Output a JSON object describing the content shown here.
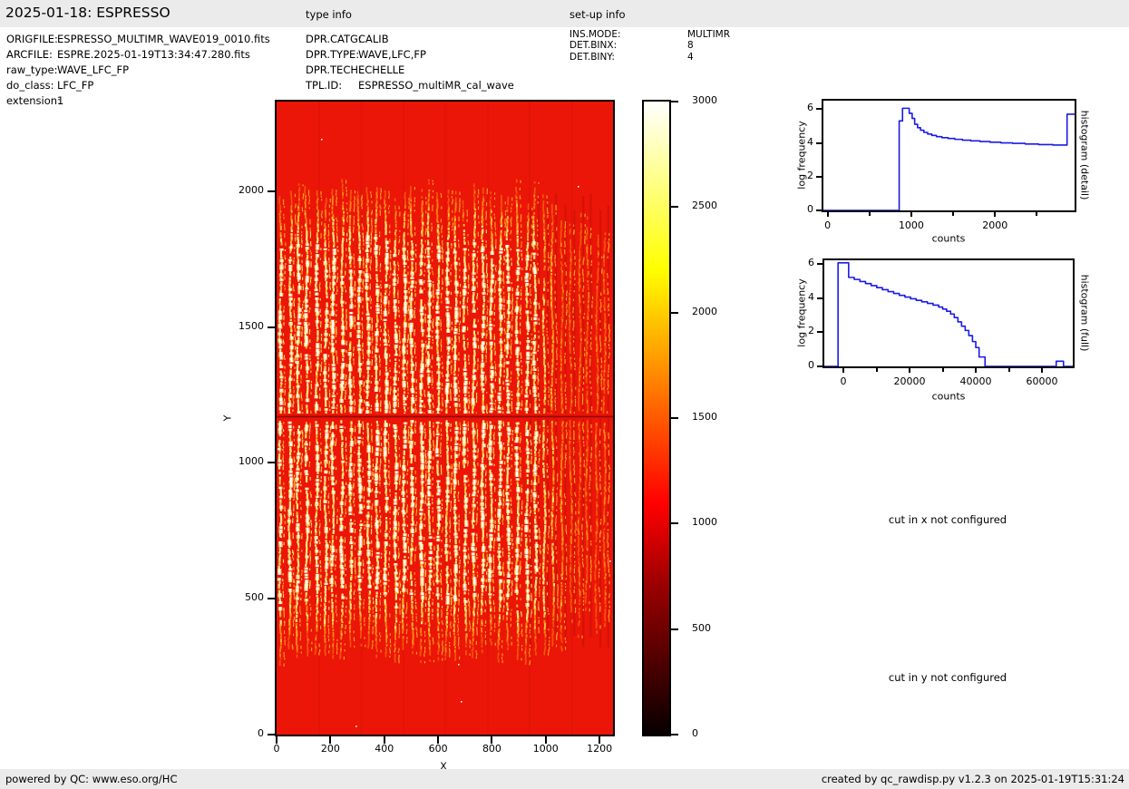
{
  "header": {
    "title": "2025-01-18: ESPRESSO",
    "type_info_label": "type info",
    "setup_info_label": "set-up info"
  },
  "file_info": [
    {
      "label": "ORIGFILE:",
      "value": "ESPRESSO_MULTIMR_WAVE019_0010.fits"
    },
    {
      "label": "ARCFILE:",
      "value": "ESPRE.2025-01-19T13:34:47.280.fits"
    },
    {
      "label": "raw_type:",
      "value": "WAVE_LFC_FP"
    },
    {
      "label": "do_class:",
      "value": "LFC_FP"
    },
    {
      "label": "extension:",
      "value": "1"
    }
  ],
  "type_info": [
    {
      "label": "DPR.CATG:",
      "value": "CALIB"
    },
    {
      "label": "DPR.TYPE:",
      "value": "WAVE,LFC,FP"
    },
    {
      "label": "DPR.TECH:",
      "value": "ECHELLE"
    },
    {
      "label": "TPL.ID:",
      "value": "ESPRESSO_multiMR_cal_wave"
    }
  ],
  "setup_info": [
    {
      "label": "INS.MODE:",
      "value": "MULTIMR"
    },
    {
      "label": "DET.BINX:",
      "value": "8"
    },
    {
      "label": "DET.BINY:",
      "value": "4"
    }
  ],
  "messages": {
    "cut_x": "cut in x not configured",
    "cut_y": "cut in y not configured"
  },
  "footer": {
    "left": "powered by QC: www.eso.org/HC",
    "right": "created by qc_rawdisp.py v1.2.3 on 2025-01-19T15:31:24"
  },
  "colors": {
    "image_red": "#eb1508",
    "histogram_line": "#1a1ae6",
    "panel_gray": "#ebebeb",
    "axis_black": "#000000"
  },
  "chart_data": [
    {
      "type": "heatmap",
      "name": "raw-frame",
      "xlabel": "X",
      "ylabel": "Y",
      "xticks": [
        0,
        200,
        400,
        600,
        800,
        1000,
        1200
      ],
      "yticks": [
        0,
        500,
        1000,
        1500,
        2000
      ],
      "xlim": [
        0,
        1250
      ],
      "ylim": [
        0,
        2330
      ],
      "colormap": "hot",
      "colorbar": {
        "min": 0,
        "max": 3000,
        "ticks": [
          0,
          500,
          1000,
          1500,
          2000,
          2500,
          3000
        ]
      },
      "features": {
        "order_count": 38,
        "orders_y_range": [
          250,
          2060
        ],
        "bright_x_max": 920,
        "gap_row_y": 1170
      }
    },
    {
      "type": "line",
      "name": "histogram-detail",
      "side_label": "histogram (detail)",
      "xlabel": "counts",
      "ylabel": "log frequency",
      "xlim": [
        -50,
        2950
      ],
      "ylim": [
        0,
        6.5
      ],
      "xticks": [
        0,
        1000,
        2000
      ],
      "xticks_minor": [
        500,
        1500,
        2500
      ],
      "yticks": [
        0,
        2,
        4,
        6
      ],
      "points": [
        [
          -50,
          0
        ],
        [
          855,
          0
        ],
        [
          855,
          5.3
        ],
        [
          895,
          5.3
        ],
        [
          895,
          6.05
        ],
        [
          975,
          6.05
        ],
        [
          975,
          5.75
        ],
        [
          1010,
          5.75
        ],
        [
          1010,
          5.45
        ],
        [
          1040,
          5.45
        ],
        [
          1040,
          5.1
        ],
        [
          1075,
          5.1
        ],
        [
          1075,
          4.9
        ],
        [
          1110,
          4.9
        ],
        [
          1110,
          4.75
        ],
        [
          1150,
          4.75
        ],
        [
          1150,
          4.62
        ],
        [
          1195,
          4.62
        ],
        [
          1195,
          4.52
        ],
        [
          1245,
          4.52
        ],
        [
          1245,
          4.44
        ],
        [
          1300,
          4.44
        ],
        [
          1300,
          4.37
        ],
        [
          1365,
          4.37
        ],
        [
          1365,
          4.31
        ],
        [
          1440,
          4.31
        ],
        [
          1440,
          4.26
        ],
        [
          1520,
          4.26
        ],
        [
          1520,
          4.21
        ],
        [
          1610,
          4.21
        ],
        [
          1610,
          4.16
        ],
        [
          1710,
          4.16
        ],
        [
          1710,
          4.12
        ],
        [
          1820,
          4.12
        ],
        [
          1820,
          4.08
        ],
        [
          1940,
          4.08
        ],
        [
          1940,
          4.04
        ],
        [
          2070,
          4.04
        ],
        [
          2070,
          4.0
        ],
        [
          2210,
          4.0
        ],
        [
          2210,
          3.97
        ],
        [
          2360,
          3.97
        ],
        [
          2360,
          3.93
        ],
        [
          2520,
          3.93
        ],
        [
          2520,
          3.9
        ],
        [
          2690,
          3.9
        ],
        [
          2690,
          3.87
        ],
        [
          2860,
          3.87
        ],
        [
          2860,
          5.7
        ],
        [
          2950,
          5.7
        ]
      ]
    },
    {
      "type": "line",
      "name": "histogram-full",
      "side_label": "histogram (full)",
      "xlabel": "counts",
      "ylabel": "log frequency",
      "xlim": [
        -5750,
        69300
      ],
      "ylim": [
        0,
        6.2
      ],
      "xticks": [
        0,
        20000,
        40000,
        60000
      ],
      "xticks_minor": [
        10000,
        30000,
        50000
      ],
      "yticks": [
        0,
        2,
        4,
        6
      ],
      "points": [
        [
          -5750,
          0
        ],
        [
          -1600,
          0
        ],
        [
          -1600,
          6.05
        ],
        [
          1600,
          6.05
        ],
        [
          1600,
          5.2
        ],
        [
          3300,
          5.2
        ],
        [
          3300,
          5.08
        ],
        [
          5000,
          5.08
        ],
        [
          5000,
          4.96
        ],
        [
          6700,
          4.96
        ],
        [
          6700,
          4.84
        ],
        [
          8400,
          4.84
        ],
        [
          8400,
          4.72
        ],
        [
          10100,
          4.72
        ],
        [
          10100,
          4.6
        ],
        [
          11800,
          4.6
        ],
        [
          11800,
          4.48
        ],
        [
          13500,
          4.48
        ],
        [
          13500,
          4.37
        ],
        [
          15200,
          4.37
        ],
        [
          15200,
          4.26
        ],
        [
          16900,
          4.26
        ],
        [
          16900,
          4.15
        ],
        [
          18600,
          4.15
        ],
        [
          18600,
          4.05
        ],
        [
          20300,
          4.05
        ],
        [
          20300,
          3.95
        ],
        [
          22000,
          3.95
        ],
        [
          22000,
          3.86
        ],
        [
          23700,
          3.86
        ],
        [
          23700,
          3.77
        ],
        [
          25400,
          3.77
        ],
        [
          25400,
          3.68
        ],
        [
          27100,
          3.68
        ],
        [
          27100,
          3.58
        ],
        [
          28800,
          3.58
        ],
        [
          28800,
          3.47
        ],
        [
          30000,
          3.47
        ],
        [
          30000,
          3.35
        ],
        [
          31200,
          3.35
        ],
        [
          31200,
          3.22
        ],
        [
          32400,
          3.22
        ],
        [
          32400,
          3.06
        ],
        [
          33500,
          3.06
        ],
        [
          33500,
          2.85
        ],
        [
          34600,
          2.85
        ],
        [
          34600,
          2.6
        ],
        [
          35700,
          2.6
        ],
        [
          35700,
          2.35
        ],
        [
          36800,
          2.35
        ],
        [
          36800,
          2.1
        ],
        [
          37900,
          2.1
        ],
        [
          37900,
          1.8
        ],
        [
          39000,
          1.8
        ],
        [
          39000,
          1.45
        ],
        [
          40000,
          1.45
        ],
        [
          40000,
          1.1
        ],
        [
          41000,
          1.1
        ],
        [
          41000,
          0.55
        ],
        [
          42800,
          0.55
        ],
        [
          42800,
          0
        ],
        [
          64300,
          0
        ],
        [
          64300,
          0.3
        ],
        [
          66500,
          0.3
        ],
        [
          66500,
          0
        ],
        [
          69300,
          0
        ]
      ]
    }
  ]
}
